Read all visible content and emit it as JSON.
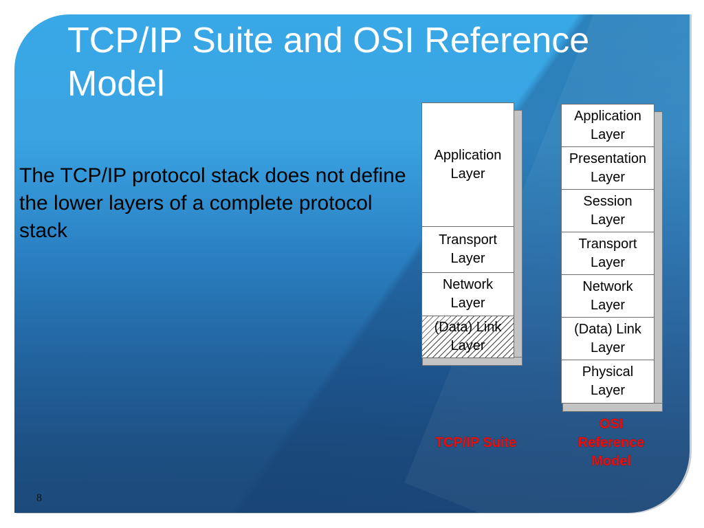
{
  "slide": {
    "title": "TCP/IP Suite and OSI Reference Model",
    "body": "The TCP/IP protocol stack does not define the lower layers of a complete protocol stack",
    "page_number": "8"
  },
  "diagram": {
    "tcpip": {
      "caption": "TCP/IP Suite",
      "layers": [
        {
          "label": "Application Layer",
          "hatched": false
        },
        {
          "label": "Transport Layer",
          "hatched": false
        },
        {
          "label": "Network Layer",
          "hatched": false
        },
        {
          "label": "(Data) Link Layer",
          "hatched": true
        }
      ]
    },
    "osi": {
      "caption": "OSI Reference Model",
      "layers": [
        {
          "label": "Application Layer"
        },
        {
          "label": "Presentation Layer"
        },
        {
          "label": "Session Layer"
        },
        {
          "label": "Transport Layer"
        },
        {
          "label": "Network Layer"
        },
        {
          "label": "(Data) Link Layer"
        },
        {
          "label": "Physical Layer"
        }
      ]
    },
    "colors": {
      "caption": "#e8100f",
      "layer_fill": "#ffffff",
      "side_fill": "#c4c4c4"
    }
  }
}
